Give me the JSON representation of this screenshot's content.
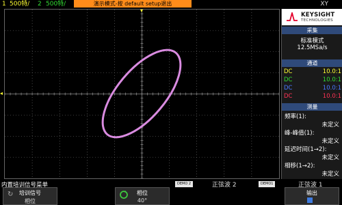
{
  "top_bar": {
    "ch1_number": "1",
    "ch1_scale": "500特/",
    "ch2_number": "2",
    "ch2_scale": "500特/",
    "demo_banner": "演示模式-按 default setup退出",
    "mode": "XY"
  },
  "brand": {
    "name": "KEYSIGHT",
    "sub": "TECHNOLOGIES"
  },
  "acquire": {
    "title": "采集",
    "mode": "标准模式",
    "rate": "12.5MSa/s"
  },
  "channels": {
    "title": "通道",
    "rows": [
      {
        "coupling": "DC",
        "ratio": "10.0:1",
        "color": "#ffff33"
      },
      {
        "coupling": "DC",
        "ratio": "10.0:1",
        "color": "#33dd33"
      },
      {
        "coupling": "DC",
        "ratio": "10.0:1",
        "color": "#4a78ff"
      },
      {
        "coupling": "DC",
        "ratio": "10.0:1",
        "color": "#ff3355"
      }
    ]
  },
  "measure": {
    "title": "测量",
    "items": [
      {
        "label": "频率(1):",
        "value": "未定义"
      },
      {
        "label": "峰-峰值(1):",
        "value": "未定义"
      },
      {
        "label": "延迟时间(1→2):",
        "value": "未定义"
      },
      {
        "label": "相移(1→2):",
        "value": "未定义"
      }
    ]
  },
  "menu": {
    "title": "内置培训信号菜单",
    "demo2_tag": "DEMO 2",
    "demo2_signal": "正弦波 2",
    "demo1_tag": "DEMO1",
    "demo1_signal": "正弦波 1",
    "softkeys": [
      {
        "line1": "培训信号",
        "line2": "相位"
      },
      {
        "line1": "相位",
        "line2": "40°"
      },
      {
        "line1": "输出",
        "line2": ""
      }
    ]
  },
  "colors": {
    "trace": "#d98be0",
    "panel_header": "#2f4a7a",
    "demo_banner": "#ff8c1a",
    "grid": "#7a7a7a"
  },
  "icons": {
    "softkey1": "circular-arrow-icon",
    "softkey2": "rotate-knob-icon",
    "softkey3": "output-on-indicator"
  }
}
